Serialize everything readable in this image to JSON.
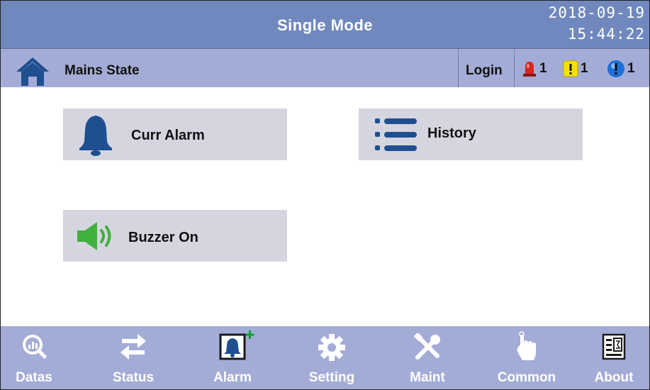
{
  "header": {
    "title": "Single Mode",
    "date": "2018-09-19",
    "time": "15:44:22"
  },
  "statebar": {
    "state_label": "Mains State",
    "login_label": "Login",
    "alarms": [
      {
        "name": "critical-alarm",
        "count": "1",
        "color": "#d8261d"
      },
      {
        "name": "warning-alarm",
        "count": "1",
        "color": "#f4e200"
      },
      {
        "name": "info-alarm",
        "count": "1",
        "color": "#1c6fd8"
      }
    ]
  },
  "main": {
    "cards": [
      {
        "id": "curr-alarm",
        "label": "Curr Alarm",
        "icon": "bell-icon"
      },
      {
        "id": "history",
        "label": "History",
        "icon": "list-icon"
      },
      {
        "id": "buzzer",
        "label": "Buzzer On",
        "icon": "speaker-icon"
      }
    ]
  },
  "nav": {
    "items": [
      {
        "label": "Datas",
        "icon": "magnifier-chart-icon"
      },
      {
        "label": "Status",
        "icon": "swap-arrows-icon"
      },
      {
        "label": "Alarm",
        "icon": "alarm-bell-icon"
      },
      {
        "label": "Setting",
        "icon": "gear-icon"
      },
      {
        "label": "Maint",
        "icon": "tools-icon"
      },
      {
        "label": "Common",
        "icon": "pointer-hand-icon"
      },
      {
        "label": "About",
        "icon": "document-icon"
      }
    ]
  },
  "colors": {
    "titlebar": "#7088bd",
    "statebar": "#a3acd6",
    "card": "#d5d5e0",
    "accent_blue": "#1f4f8f",
    "speaker_green": "#3fb13c"
  }
}
